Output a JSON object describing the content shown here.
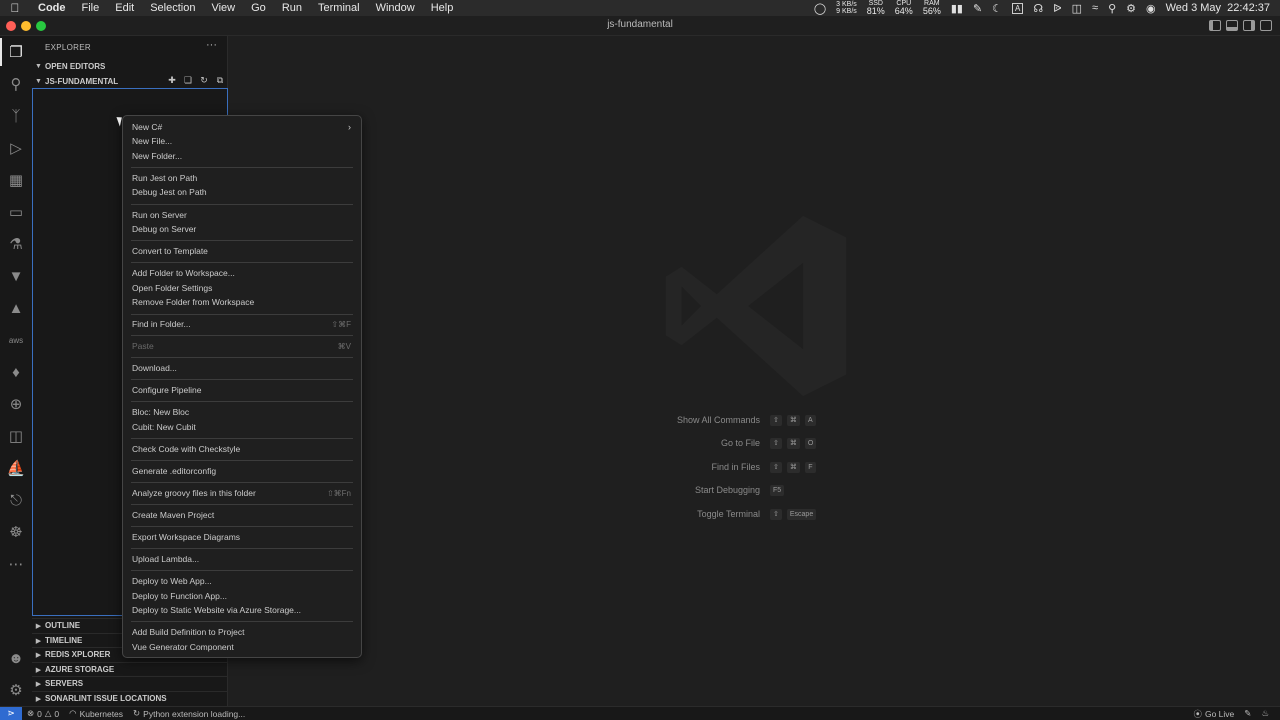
{
  "menubar": {
    "app": "Code",
    "items": [
      "File",
      "Edit",
      "Selection",
      "View",
      "Go",
      "Run",
      "Terminal",
      "Window",
      "Help"
    ],
    "net_up": "3 KB/s",
    "net_down": "9 KB/s",
    "ssd_label": "SSD",
    "ssd_value": "81%",
    "cpu_label": "CPU",
    "cpu_value": "64%",
    "ram_label": "RAM",
    "ram_value": "56%",
    "input_source": "A",
    "datetime": "Wed 3 May  22:42:37"
  },
  "window": {
    "title": "js-fundamental",
    "colors": {
      "close": "#ff5f57",
      "minimize": "#febc2e",
      "zoom": "#28c840",
      "accent": "#2f6bd1"
    }
  },
  "sidebar": {
    "title": "EXPLORER",
    "more": "···",
    "open_editors": "OPEN EDITORS",
    "folder": "JS-FUNDAMENTAL",
    "bottom_sections": [
      "OUTLINE",
      "TIMELINE",
      "REDIS XPLORER",
      "AZURE STORAGE",
      "SERVERS",
      "SONARLINT ISSUE LOCATIONS"
    ]
  },
  "context_menu": {
    "groups": [
      [
        {
          "label": "New C#",
          "submenu": true
        },
        {
          "label": "New File..."
        },
        {
          "label": "New Folder..."
        }
      ],
      [
        {
          "label": "Run Jest on Path"
        },
        {
          "label": "Debug Jest on Path"
        }
      ],
      [
        {
          "label": "Run on Server"
        },
        {
          "label": "Debug on Server"
        }
      ],
      [
        {
          "label": "Convert to Template"
        }
      ],
      [
        {
          "label": "Add Folder to Workspace..."
        },
        {
          "label": "Open Folder Settings"
        },
        {
          "label": "Remove Folder from Workspace"
        }
      ],
      [
        {
          "label": "Find in Folder...",
          "shortcut": "⇧⌘F"
        }
      ],
      [
        {
          "label": "Paste",
          "shortcut": "⌘V",
          "disabled": true
        }
      ],
      [
        {
          "label": "Download..."
        }
      ],
      [
        {
          "label": "Configure Pipeline"
        }
      ],
      [
        {
          "label": "Bloc: New Bloc"
        },
        {
          "label": "Cubit: New Cubit"
        }
      ],
      [
        {
          "label": "Check Code with Checkstyle"
        }
      ],
      [
        {
          "label": "Generate .editorconfig"
        }
      ],
      [
        {
          "label": "Analyze groovy files in this folder",
          "shortcut": "⇧⌘Fn"
        }
      ],
      [
        {
          "label": "Create Maven Project"
        }
      ],
      [
        {
          "label": "Export Workspace Diagrams"
        }
      ],
      [
        {
          "label": "Upload Lambda..."
        }
      ],
      [
        {
          "label": "Deploy to Web App..."
        },
        {
          "label": "Deploy to Function App..."
        },
        {
          "label": "Deploy to Static Website via Azure Storage..."
        }
      ],
      [
        {
          "label": "Add Build Definition to Project"
        },
        {
          "label": "Vue Generator Component"
        }
      ]
    ]
  },
  "editor_hints": [
    {
      "label": "Show All Commands",
      "keys": [
        "⇧",
        "⌘",
        "A"
      ]
    },
    {
      "label": "Go to File",
      "keys": [
        "⇧",
        "⌘",
        "O"
      ]
    },
    {
      "label": "Find in Files",
      "keys": [
        "⇧",
        "⌘",
        "F"
      ]
    },
    {
      "label": "Start Debugging",
      "keys": [
        "F5"
      ]
    },
    {
      "label": "Toggle Terminal",
      "keys": [
        "⇧",
        "Escape"
      ]
    }
  ],
  "statusbar": {
    "errors": "0",
    "warnings": "0",
    "kubernetes": "Kubernetes",
    "python": "Python extension loading...",
    "go_live": "Go Live"
  }
}
